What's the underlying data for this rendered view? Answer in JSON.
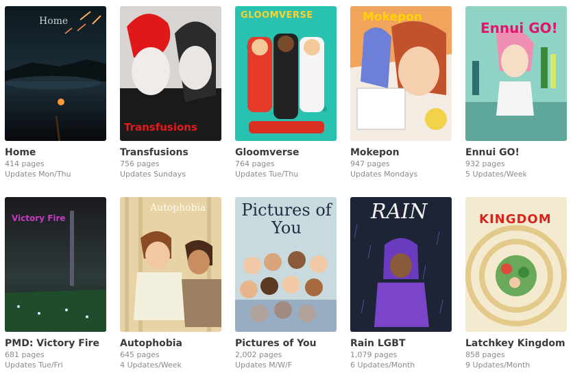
{
  "comics": [
    {
      "title": "Home",
      "pages": "414 pages",
      "schedule": "Updates Mon/Thu",
      "cover_text": "Home"
    },
    {
      "title": "Transfusions",
      "pages": "756 pages",
      "schedule": "Updates Sundays",
      "cover_text": "Transfusions"
    },
    {
      "title": "Gloomverse",
      "pages": "764 pages",
      "schedule": "Updates Tue/Thu",
      "cover_text": "GLOOMVERSE"
    },
    {
      "title": "Mokepon",
      "pages": "947 pages",
      "schedule": "Updates Mondays",
      "cover_text": "Mokepon"
    },
    {
      "title": "Ennui GO!",
      "pages": "932 pages",
      "schedule": "5 Updates/Week",
      "cover_text": "Ennui GO!"
    },
    {
      "title": "PMD: Victory Fire",
      "pages": "681 pages",
      "schedule": "Updates Tue/Fri",
      "cover_text": "Victory Fire"
    },
    {
      "title": "Autophobia",
      "pages": "645 pages",
      "schedule": "4 Updates/Week",
      "cover_text": "Autophobia"
    },
    {
      "title": "Pictures of You",
      "pages": "2,002 pages",
      "schedule": "Updates M/W/F",
      "cover_text": "Pictures of You"
    },
    {
      "title": "Rain LGBT",
      "pages": "1,079 pages",
      "schedule": "6 Updates/Month",
      "cover_text": "RAIN"
    },
    {
      "title": "Latchkey Kingdom",
      "pages": "858 pages",
      "schedule": "9 Updates/Month",
      "cover_text": "KINGDOM"
    }
  ]
}
